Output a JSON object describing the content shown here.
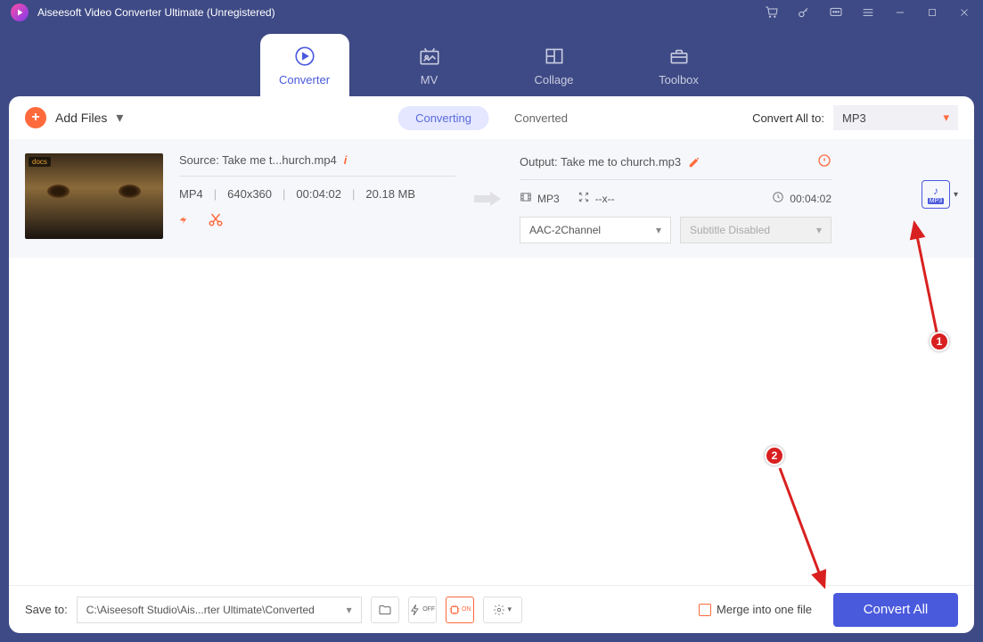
{
  "title": "Aiseesoft Video Converter Ultimate (Unregistered)",
  "tabs": {
    "converter": "Converter",
    "mv": "MV",
    "collage": "Collage",
    "toolbox": "Toolbox"
  },
  "toolbar": {
    "add": "Add Files"
  },
  "subtabs": {
    "converting": "Converting",
    "converted": "Converted"
  },
  "convert_to": {
    "label": "Convert All to:",
    "value": "MP3"
  },
  "item": {
    "source_label": "Source: Take me t...hurch.mp4",
    "fmt": "MP4",
    "res": "640x360",
    "dur": "00:04:02",
    "size": "20.18 MB",
    "output_label": "Output: Take me to church.mp3",
    "out_fmt": "MP3",
    "out_res": "--x--",
    "out_dur": "00:04:02",
    "audio": "AAC-2Channel",
    "subtitle": "Subtitle Disabled",
    "fmt_ext": "MP3"
  },
  "bottom": {
    "save_label": "Save to:",
    "path": "C:\\Aiseesoft Studio\\Ais...rter Ultimate\\Converted",
    "merge": "Merge into one file",
    "convert": "Convert All"
  },
  "callouts": {
    "one": "1",
    "two": "2"
  }
}
